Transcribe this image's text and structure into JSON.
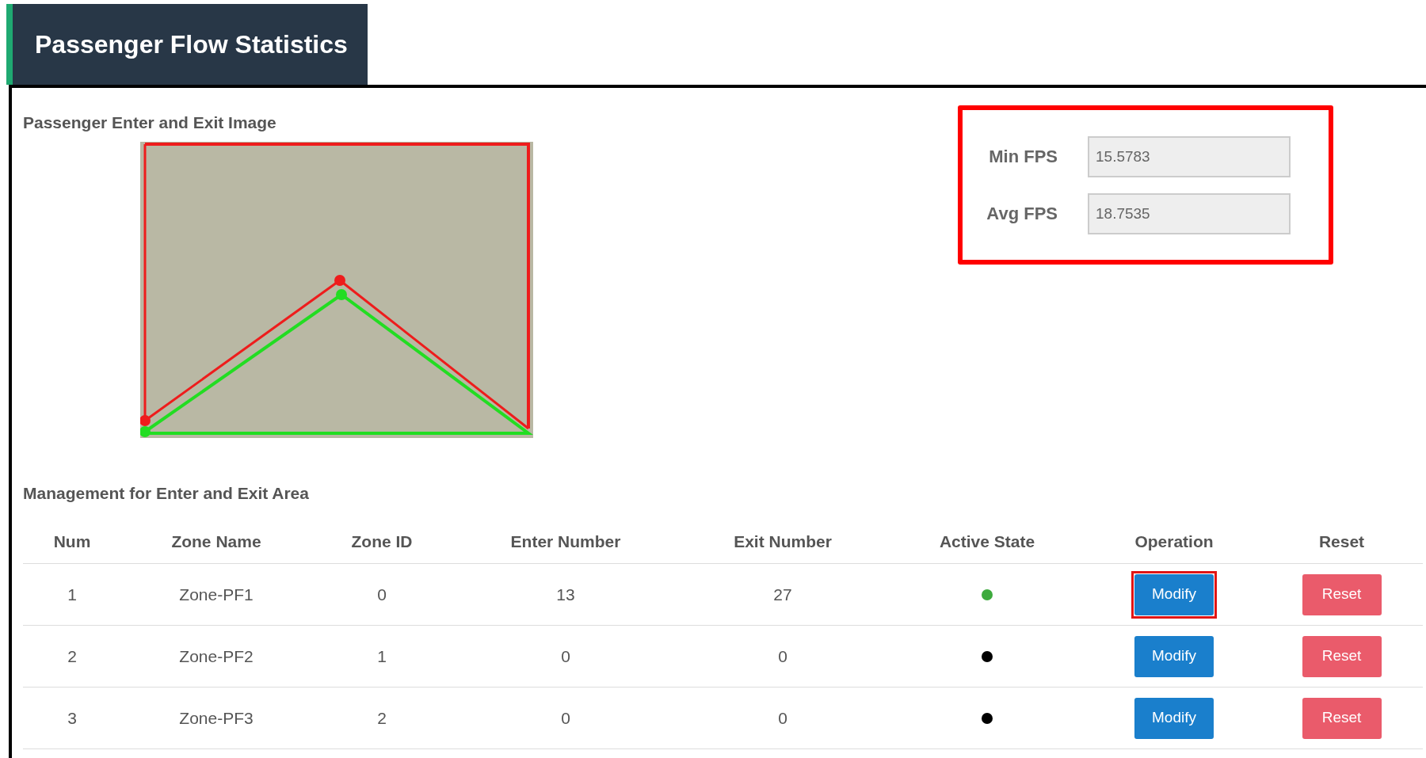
{
  "page_title": "Passenger Flow Statistics",
  "image_section": {
    "title": "Passenger Enter and Exit Image"
  },
  "fps_panel": {
    "highlighted": true,
    "fields": [
      {
        "label": "Min FPS",
        "value": "15.5783"
      },
      {
        "label": "Avg FPS",
        "value": "18.7535"
      }
    ]
  },
  "management": {
    "title": "Management for Enter and Exit Area",
    "columns": [
      "Num",
      "Zone Name",
      "Zone ID",
      "Enter Number",
      "Exit Number",
      "Active State",
      "Operation",
      "Reset"
    ],
    "rows": [
      {
        "num": "1",
        "zone_name": "Zone-PF1",
        "zone_id": "0",
        "enter": "13",
        "exit": "27",
        "active": true,
        "modify": "Modify",
        "modify_highlighted": true,
        "reset": "Reset"
      },
      {
        "num": "2",
        "zone_name": "Zone-PF2",
        "zone_id": "1",
        "enter": "0",
        "exit": "0",
        "active": false,
        "modify": "Modify",
        "modify_highlighted": false,
        "reset": "Reset"
      },
      {
        "num": "3",
        "zone_name": "Zone-PF3",
        "zone_id": "2",
        "enter": "0",
        "exit": "0",
        "active": false,
        "modify": "Modify",
        "modify_highlighted": false,
        "reset": "Reset"
      }
    ]
  }
}
